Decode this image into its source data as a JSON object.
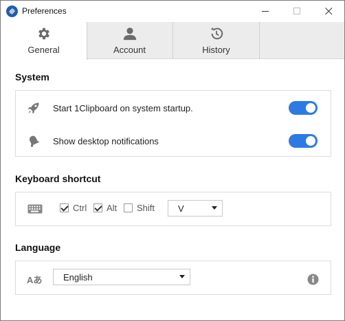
{
  "window": {
    "title": "Preferences",
    "minimize": "—",
    "maximize": "☐",
    "close": "✕"
  },
  "tabs": [
    {
      "label": "General",
      "icon": "gear-icon",
      "active": true
    },
    {
      "label": "Account",
      "icon": "user-icon",
      "active": false
    },
    {
      "label": "History",
      "icon": "history-icon",
      "active": false
    }
  ],
  "system": {
    "title": "System",
    "startup_label": "Start 1Clipboard on system startup.",
    "startup_on": true,
    "notifications_label": "Show desktop notifications",
    "notifications_on": true
  },
  "keyboard": {
    "title": "Keyboard shortcut",
    "ctrl_label": "Ctrl",
    "ctrl_checked": true,
    "alt_label": "Alt",
    "alt_checked": true,
    "shift_label": "Shift",
    "shift_checked": false,
    "key_value": "V"
  },
  "language": {
    "title": "Language",
    "icon_text": "Aあ",
    "selected": "English"
  },
  "colors": {
    "toggle_on": "#2c7be5",
    "app_icon": "#1f5fa8"
  }
}
